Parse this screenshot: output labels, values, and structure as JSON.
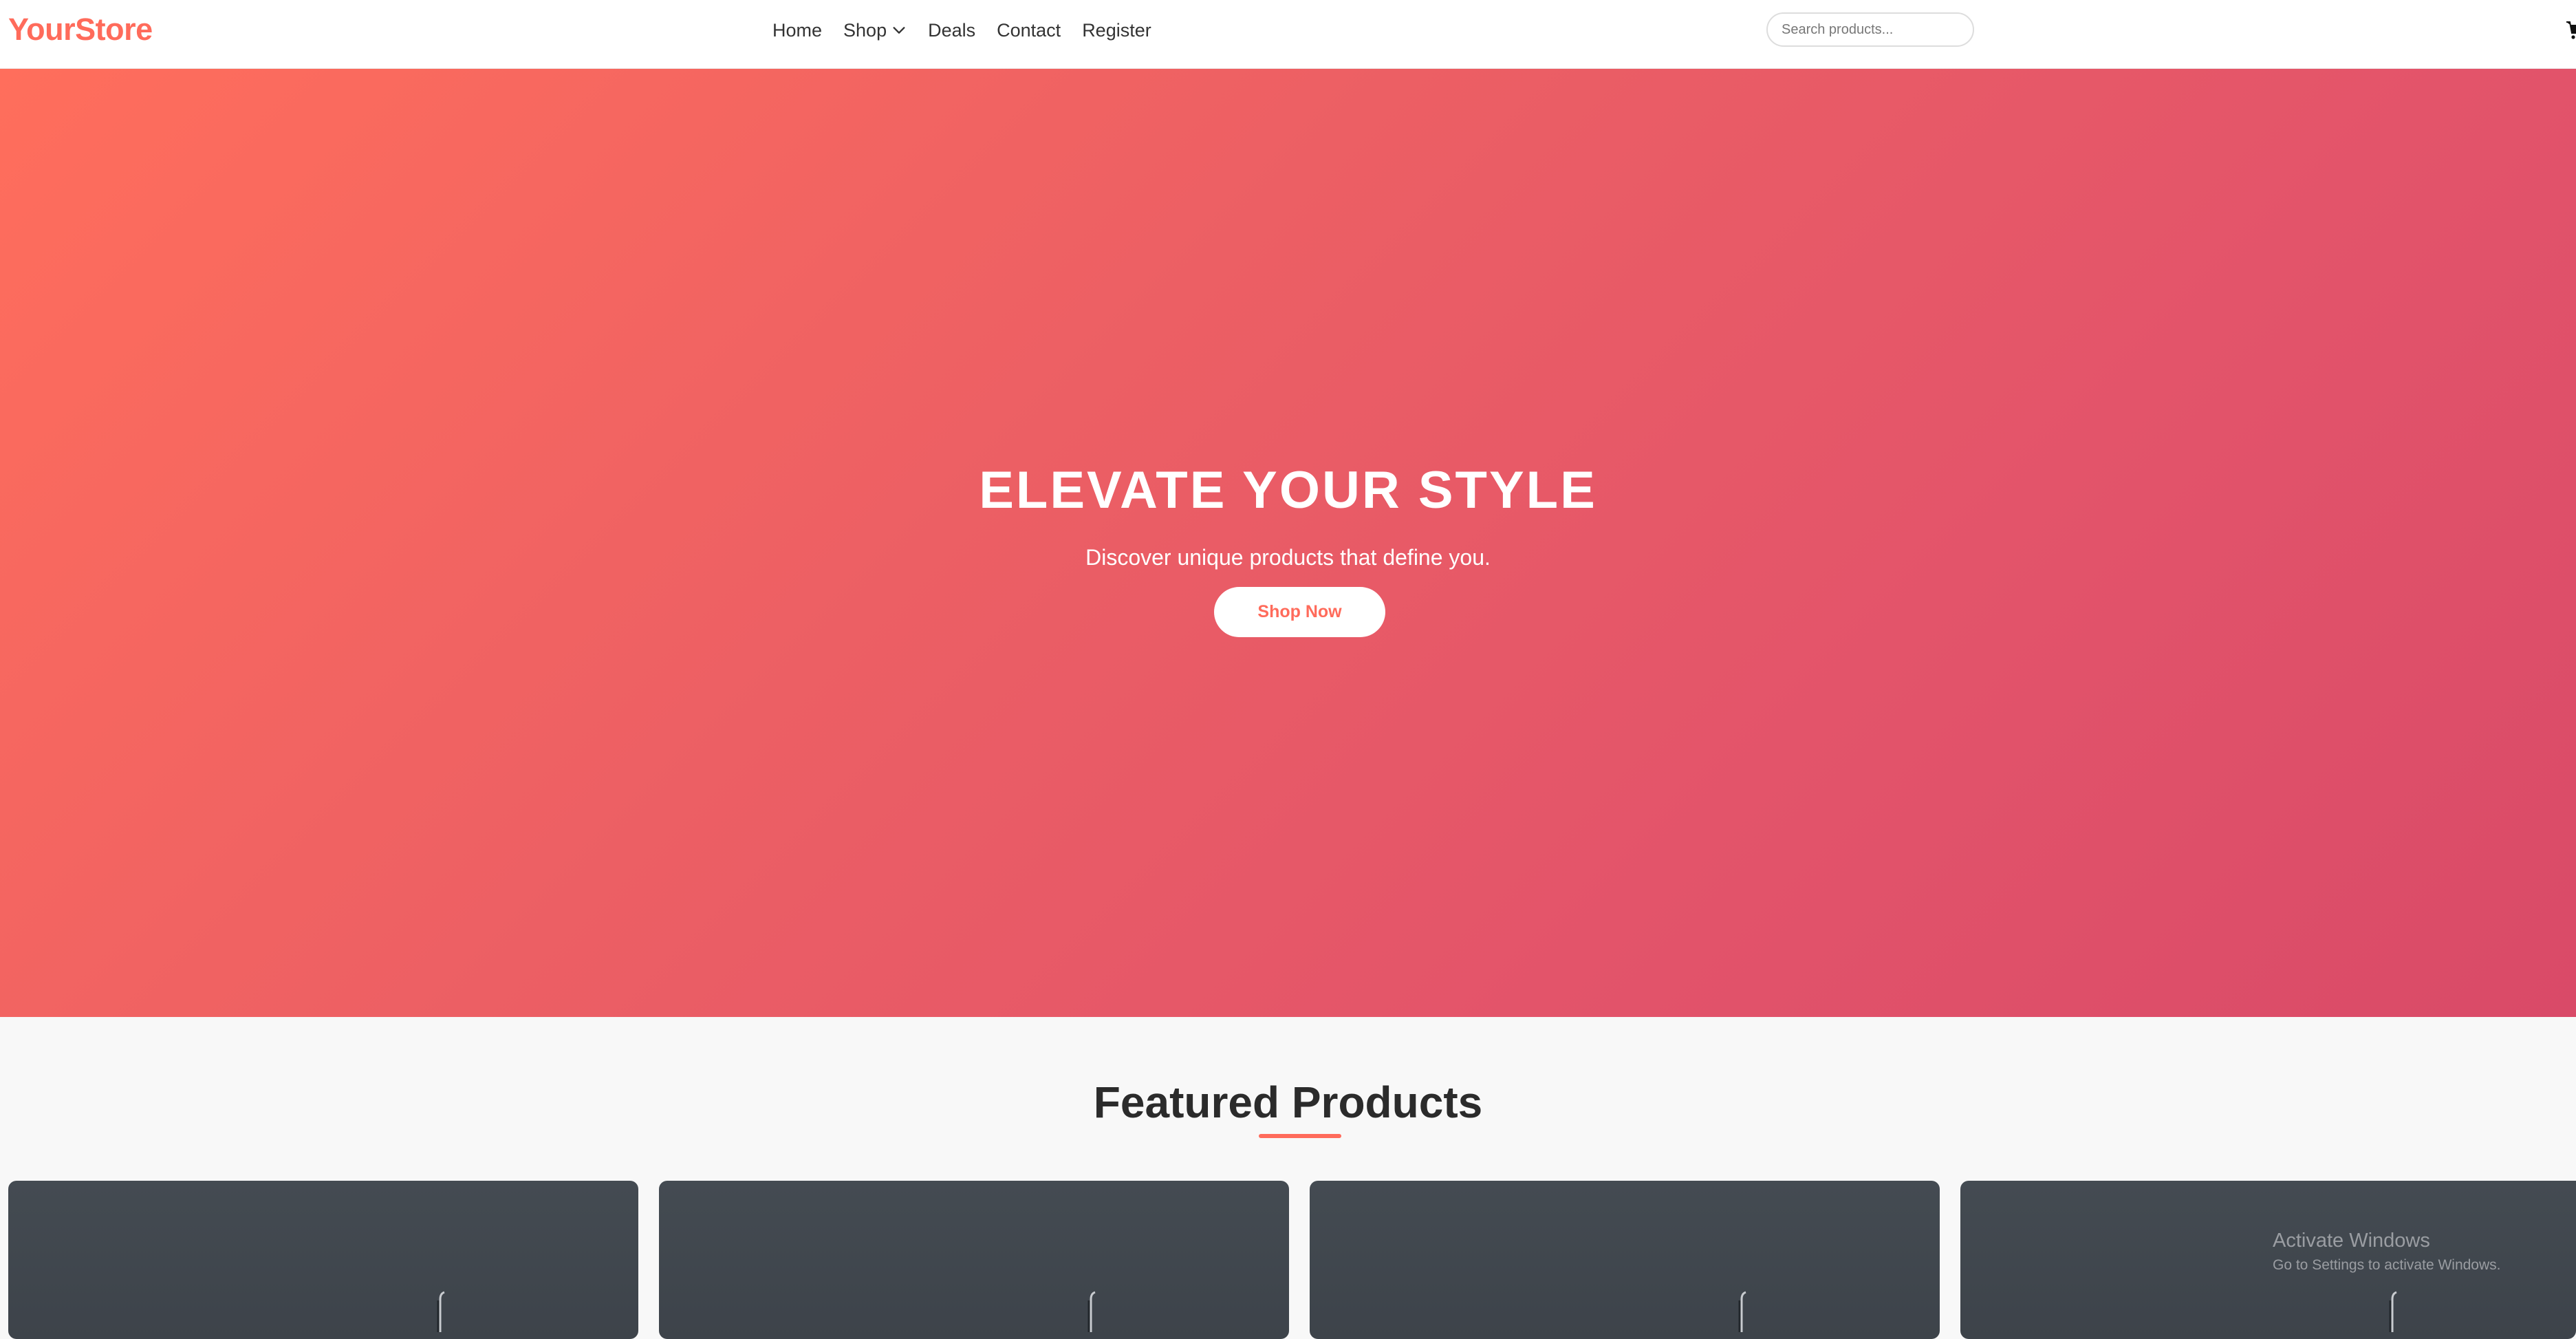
{
  "brand": {
    "name": "YourStore",
    "accent_color": "#ff6b5b"
  },
  "nav": {
    "links": [
      "Home",
      "Shop",
      "Deals",
      "Contact",
      "Register"
    ]
  },
  "search": {
    "placeholder": "Search products...",
    "value": ""
  },
  "cart": {
    "icon": "cart-icon"
  },
  "hero": {
    "title": "ELEVATE YOUR STYLE",
    "subtitle": "Discover unique products that define you.",
    "cta_label": "Shop Now",
    "gradient_start": "#ff6e5c",
    "gradient_end": "#d94a68"
  },
  "featured": {
    "title": "Featured Products",
    "products": [
      {
        "image": "product-image"
      },
      {
        "image": "product-image"
      },
      {
        "image": "product-image"
      },
      {
        "image": "product-image"
      }
    ]
  },
  "watermark": {
    "title": "Activate Windows",
    "subtitle": "Go to Settings to activate Windows."
  }
}
